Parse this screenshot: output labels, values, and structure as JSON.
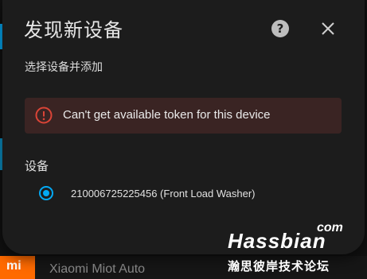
{
  "dialog": {
    "title": "发现新设备",
    "subtitle": "选择设备并添加",
    "error": "Can't get available token for this device",
    "section_label": "设备",
    "device": {
      "label": "210006725225456 (Front Load Washer)",
      "selected": true
    },
    "icons": {
      "help": "help-circle-icon",
      "close": "close-icon",
      "error": "alert-circle-icon"
    },
    "colors": {
      "accent": "#03a9f4",
      "error_bg": "#3a2423",
      "error_icon": "#db4437"
    }
  },
  "background": {
    "row_label": "Xiaomi Miot Auto",
    "row_icon_text": "mi"
  },
  "watermark": {
    "brand": "Hassbian",
    "suffix": "com",
    "tagline": "瀚思彼岸技术论坛"
  }
}
